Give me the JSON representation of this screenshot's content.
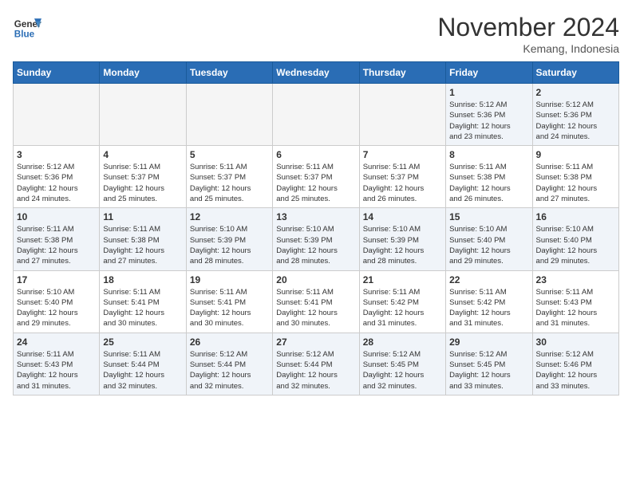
{
  "header": {
    "logo_line1": "General",
    "logo_line2": "Blue",
    "month": "November 2024",
    "location": "Kemang, Indonesia"
  },
  "days_of_week": [
    "Sunday",
    "Monday",
    "Tuesday",
    "Wednesday",
    "Thursday",
    "Friday",
    "Saturday"
  ],
  "weeks": [
    [
      {
        "day": "",
        "info": ""
      },
      {
        "day": "",
        "info": ""
      },
      {
        "day": "",
        "info": ""
      },
      {
        "day": "",
        "info": ""
      },
      {
        "day": "",
        "info": ""
      },
      {
        "day": "1",
        "info": "Sunrise: 5:12 AM\nSunset: 5:36 PM\nDaylight: 12 hours\nand 23 minutes."
      },
      {
        "day": "2",
        "info": "Sunrise: 5:12 AM\nSunset: 5:36 PM\nDaylight: 12 hours\nand 24 minutes."
      }
    ],
    [
      {
        "day": "3",
        "info": "Sunrise: 5:12 AM\nSunset: 5:36 PM\nDaylight: 12 hours\nand 24 minutes."
      },
      {
        "day": "4",
        "info": "Sunrise: 5:11 AM\nSunset: 5:37 PM\nDaylight: 12 hours\nand 25 minutes."
      },
      {
        "day": "5",
        "info": "Sunrise: 5:11 AM\nSunset: 5:37 PM\nDaylight: 12 hours\nand 25 minutes."
      },
      {
        "day": "6",
        "info": "Sunrise: 5:11 AM\nSunset: 5:37 PM\nDaylight: 12 hours\nand 25 minutes."
      },
      {
        "day": "7",
        "info": "Sunrise: 5:11 AM\nSunset: 5:37 PM\nDaylight: 12 hours\nand 26 minutes."
      },
      {
        "day": "8",
        "info": "Sunrise: 5:11 AM\nSunset: 5:38 PM\nDaylight: 12 hours\nand 26 minutes."
      },
      {
        "day": "9",
        "info": "Sunrise: 5:11 AM\nSunset: 5:38 PM\nDaylight: 12 hours\nand 27 minutes."
      }
    ],
    [
      {
        "day": "10",
        "info": "Sunrise: 5:11 AM\nSunset: 5:38 PM\nDaylight: 12 hours\nand 27 minutes."
      },
      {
        "day": "11",
        "info": "Sunrise: 5:11 AM\nSunset: 5:38 PM\nDaylight: 12 hours\nand 27 minutes."
      },
      {
        "day": "12",
        "info": "Sunrise: 5:10 AM\nSunset: 5:39 PM\nDaylight: 12 hours\nand 28 minutes."
      },
      {
        "day": "13",
        "info": "Sunrise: 5:10 AM\nSunset: 5:39 PM\nDaylight: 12 hours\nand 28 minutes."
      },
      {
        "day": "14",
        "info": "Sunrise: 5:10 AM\nSunset: 5:39 PM\nDaylight: 12 hours\nand 28 minutes."
      },
      {
        "day": "15",
        "info": "Sunrise: 5:10 AM\nSunset: 5:40 PM\nDaylight: 12 hours\nand 29 minutes."
      },
      {
        "day": "16",
        "info": "Sunrise: 5:10 AM\nSunset: 5:40 PM\nDaylight: 12 hours\nand 29 minutes."
      }
    ],
    [
      {
        "day": "17",
        "info": "Sunrise: 5:10 AM\nSunset: 5:40 PM\nDaylight: 12 hours\nand 29 minutes."
      },
      {
        "day": "18",
        "info": "Sunrise: 5:11 AM\nSunset: 5:41 PM\nDaylight: 12 hours\nand 30 minutes."
      },
      {
        "day": "19",
        "info": "Sunrise: 5:11 AM\nSunset: 5:41 PM\nDaylight: 12 hours\nand 30 minutes."
      },
      {
        "day": "20",
        "info": "Sunrise: 5:11 AM\nSunset: 5:41 PM\nDaylight: 12 hours\nand 30 minutes."
      },
      {
        "day": "21",
        "info": "Sunrise: 5:11 AM\nSunset: 5:42 PM\nDaylight: 12 hours\nand 31 minutes."
      },
      {
        "day": "22",
        "info": "Sunrise: 5:11 AM\nSunset: 5:42 PM\nDaylight: 12 hours\nand 31 minutes."
      },
      {
        "day": "23",
        "info": "Sunrise: 5:11 AM\nSunset: 5:43 PM\nDaylight: 12 hours\nand 31 minutes."
      }
    ],
    [
      {
        "day": "24",
        "info": "Sunrise: 5:11 AM\nSunset: 5:43 PM\nDaylight: 12 hours\nand 31 minutes."
      },
      {
        "day": "25",
        "info": "Sunrise: 5:11 AM\nSunset: 5:44 PM\nDaylight: 12 hours\nand 32 minutes."
      },
      {
        "day": "26",
        "info": "Sunrise: 5:12 AM\nSunset: 5:44 PM\nDaylight: 12 hours\nand 32 minutes."
      },
      {
        "day": "27",
        "info": "Sunrise: 5:12 AM\nSunset: 5:44 PM\nDaylight: 12 hours\nand 32 minutes."
      },
      {
        "day": "28",
        "info": "Sunrise: 5:12 AM\nSunset: 5:45 PM\nDaylight: 12 hours\nand 32 minutes."
      },
      {
        "day": "29",
        "info": "Sunrise: 5:12 AM\nSunset: 5:45 PM\nDaylight: 12 hours\nand 33 minutes."
      },
      {
        "day": "30",
        "info": "Sunrise: 5:12 AM\nSunset: 5:46 PM\nDaylight: 12 hours\nand 33 minutes."
      }
    ]
  ]
}
